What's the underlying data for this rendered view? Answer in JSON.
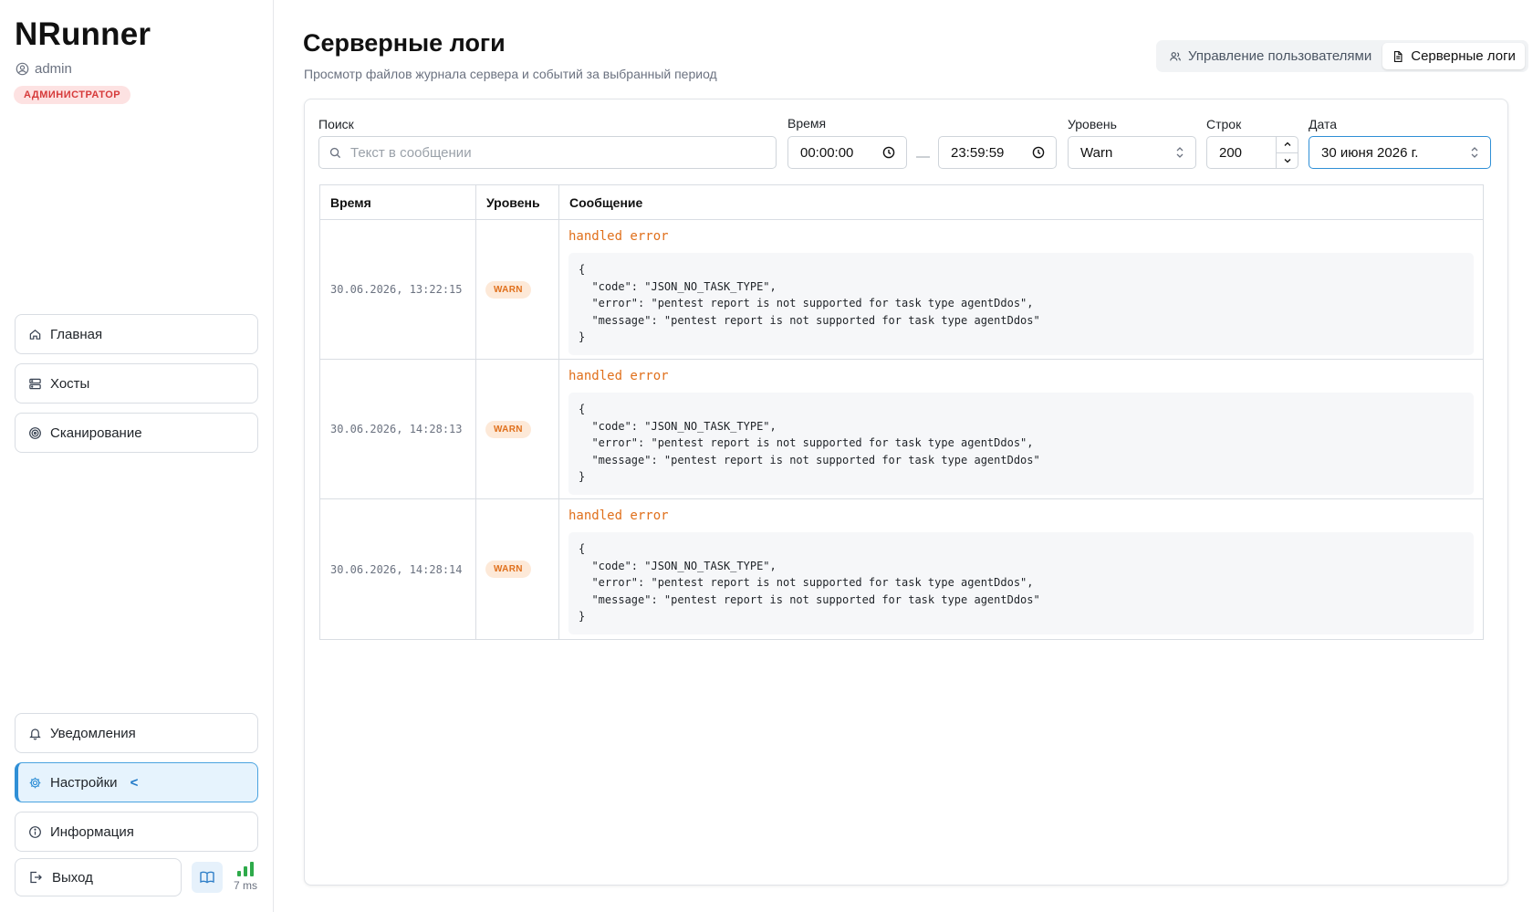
{
  "app": {
    "name": "NRunner",
    "user": "admin",
    "role": "АДМИНИСТРАТОР"
  },
  "sidebar": {
    "top_items": [
      {
        "label": "Главная",
        "icon": "home-icon"
      },
      {
        "label": "Хосты",
        "icon": "server-icon"
      },
      {
        "label": "Сканирование",
        "icon": "target-icon"
      }
    ],
    "bottom_items": [
      {
        "label": "Уведомления",
        "icon": "bell-icon"
      },
      {
        "label": "Настройки",
        "icon": "gear-icon",
        "active": true,
        "indicator": "<"
      },
      {
        "label": "Информация",
        "icon": "info-icon"
      }
    ],
    "logout_label": "Выход",
    "latency": "7 ms"
  },
  "page": {
    "title": "Серверные логи",
    "subtitle": "Просмотр файлов журнала сервера и событий за выбранный период"
  },
  "tabs": [
    {
      "label": "Управление пользователями",
      "icon": "users-icon"
    },
    {
      "label": "Серверные логи",
      "icon": "file-icon",
      "active": true
    }
  ],
  "filters": {
    "search": {
      "label": "Поиск",
      "placeholder": "Текст в сообщении",
      "value": ""
    },
    "time": {
      "label": "Время",
      "from": "00:00:00",
      "to": "23:59:59",
      "separator": "—"
    },
    "level": {
      "label": "Уровень",
      "value": "Warn"
    },
    "rows": {
      "label": "Строк",
      "value": "200"
    },
    "date": {
      "label": "Дата",
      "value": "30 июня 2026 г."
    }
  },
  "table": {
    "headers": [
      "Время",
      "Уровень",
      "Сообщение"
    ],
    "rows": [
      {
        "time": "30.06.2026, 13:22:15",
        "level": "WARN",
        "message": "handled error",
        "details": "{\n  \"code\": \"JSON_NO_TASK_TYPE\",\n  \"error\": \"pentest report is not supported for task type agentDdos\",\n  \"message\": \"pentest report is not supported for task type agentDdos\"\n}"
      },
      {
        "time": "30.06.2026, 14:28:13",
        "level": "WARN",
        "message": "handled error",
        "details": "{\n  \"code\": \"JSON_NO_TASK_TYPE\",\n  \"error\": \"pentest report is not supported for task type agentDdos\",\n  \"message\": \"pentest report is not supported for task type agentDdos\"\n}"
      },
      {
        "time": "30.06.2026, 14:28:14",
        "level": "WARN",
        "message": "handled error",
        "details": "{\n  \"code\": \"JSON_NO_TASK_TYPE\",\n  \"error\": \"pentest report is not supported for task type agentDdos\",\n  \"message\": \"pentest report is not supported for task type agentDdos\"\n}"
      }
    ]
  },
  "colors": {
    "accent": "#2f8fd6",
    "warn": "#e0701c",
    "role_badge": "#d63a3a"
  }
}
